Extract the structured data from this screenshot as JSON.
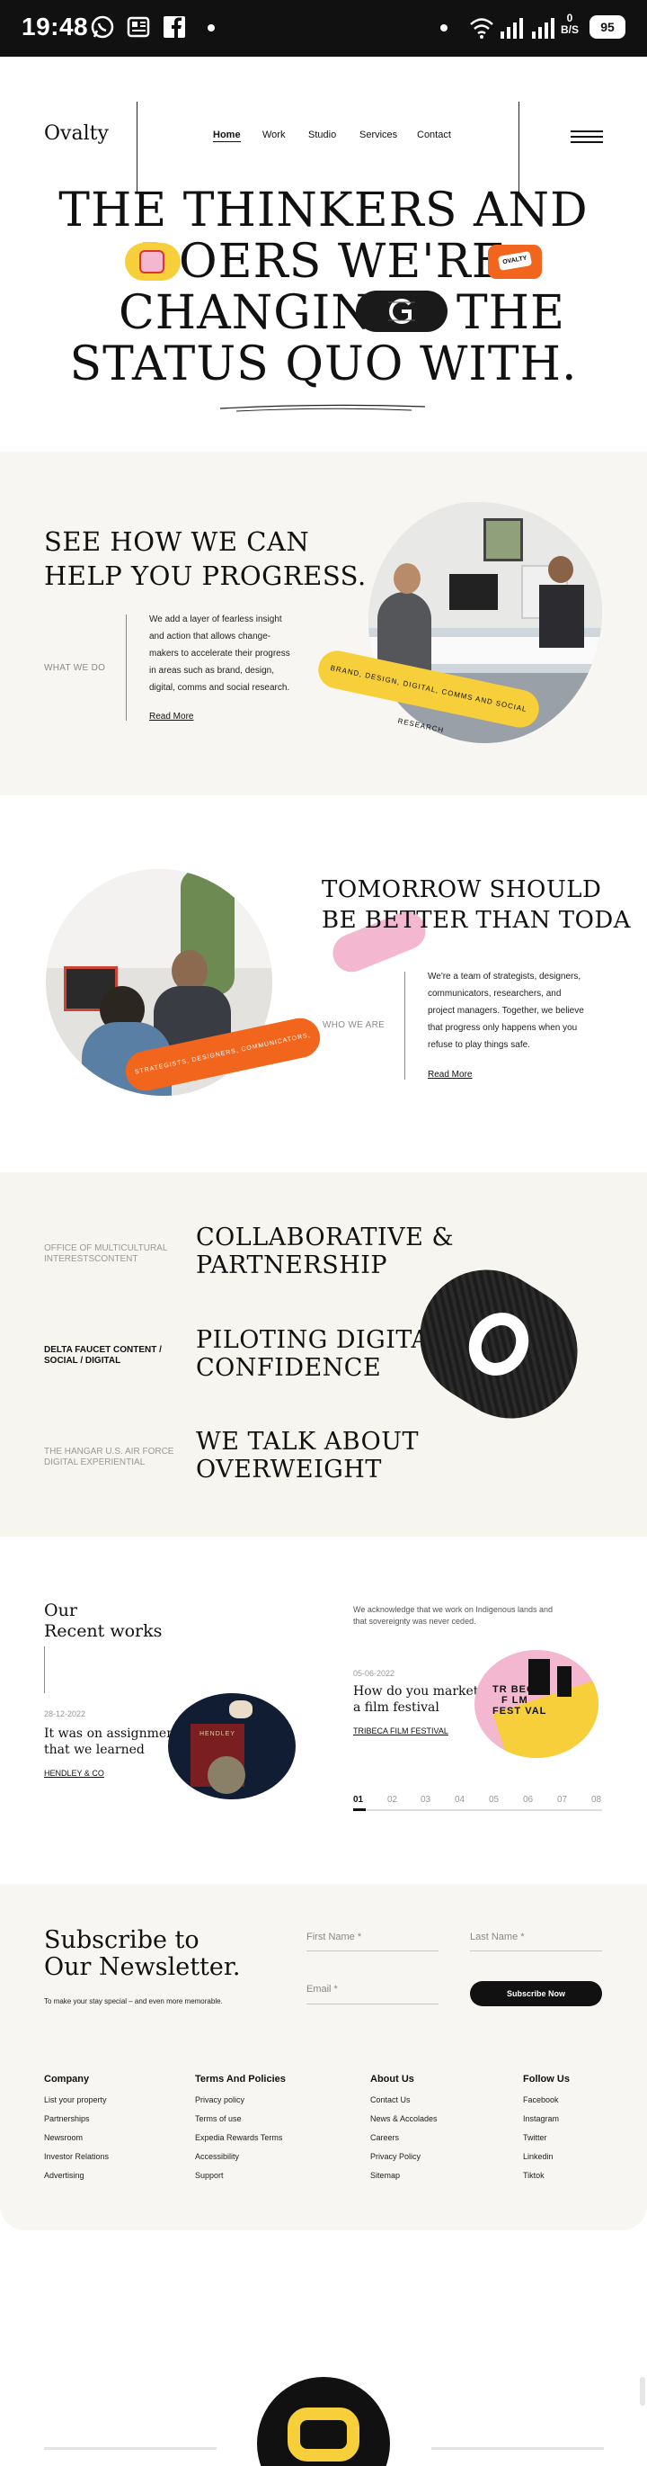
{
  "status_bar": {
    "time": "19:48",
    "net_speed_top": "0",
    "net_speed_bottom": "B/S",
    "battery": "95"
  },
  "header": {
    "logo": "Ovalty",
    "nav": [
      "Home",
      "Work",
      "Studio",
      "Services",
      "Contact"
    ]
  },
  "hero": {
    "line1": "THE THINKERS AND",
    "line2": "DOERS WE'RE",
    "line3_left": "CHANGING",
    "line3_right": "THE",
    "line4": "STATUS QUO WITH.",
    "sticker_text": "OVALTY"
  },
  "progress": {
    "title_line1": "SEE HOW WE CAN",
    "title_line2": "HELP YOU PROGRESS.",
    "label": "WHAT WE DO",
    "paragraph": [
      "We add a layer of fearless insight",
      "and action that allows change-",
      "makers to accelerate their progress",
      "in areas such as brand, design,",
      "digital, comms and social research."
    ],
    "link": "Read More",
    "ribbon": "BRAND, DESIGN, DIGITAL, COMMS AND SOCIAL RESEARCH"
  },
  "tomorrow": {
    "title_line1": "TOMORROW SHOULD",
    "title_line2": "BE BETTER THAN TODA",
    "label": "WHO WE ARE",
    "paragraph": [
      "We're a team of strategists, designers,",
      "communicators, researchers, and",
      "project managers. Together, we believe",
      "that progress only happens when you",
      "refuse to play things safe."
    ],
    "link": "Read More",
    "ribbon": "STRATEGISTS, DESIGNERS, COMMUNICATORS, RESEARCHERS"
  },
  "services": [
    {
      "label_line1": "OFFICE OF MULTICULTURAL",
      "label_line2": "INTERESTSCONTENT",
      "title_line1": "COLLABORATIVE &",
      "title_line2": "PARTNERSHIP"
    },
    {
      "label_line1": "DELTA FAUCET CONTENT /",
      "label_line2": "SOCIAL / DIGITAL",
      "title_line1": "PILOTING DIGITAL",
      "title_line2": "CONFIDENCE"
    },
    {
      "label_line1": "THE HANGAR U.S. AIR FORCE",
      "label_line2": "DIGITAL EXPERIENTIAL",
      "title_line1": "WE TALK ABOUT",
      "title_line2": "OVERWEIGHT"
    }
  ],
  "works": {
    "title_line1": "Our",
    "title_line2": "Recent works",
    "ack_line1": "We acknowledge that we work on Indigenous lands and",
    "ack_line2": "that sovereignty was never ceded.",
    "left": {
      "date": "28-12-2022",
      "title_line1": "It was on assignment",
      "title_line2": "that we learned",
      "client": "HENDLEY & CO",
      "card_brand": "HENDLEY"
    },
    "right": {
      "date": "05-06-2022",
      "title_line1": "How do you market",
      "title_line2": "a film festival",
      "client": "TRIBECA FILM FESTIVAL",
      "poster": [
        "TR",
        "BECA",
        "F",
        "LM",
        "FEST",
        "VAL"
      ]
    },
    "pager": [
      "01",
      "02",
      "03",
      "04",
      "05",
      "06",
      "07",
      "08"
    ],
    "active_page": 1
  },
  "subscribe": {
    "title_line1": "Subscribe to",
    "title_line2": "Our Newsletter.",
    "subtitle": "To make your stay special – and even more memorable.",
    "first_name": "First Name *",
    "last_name": "Last Name *",
    "email": "Email *",
    "button": "Subscribe Now"
  },
  "footer": {
    "columns": [
      {
        "title": "Company",
        "items": [
          "List your property",
          "Partnerships",
          "Newsroom",
          "Investor Relations",
          "Advertising"
        ]
      },
      {
        "title": "Terms And Policies",
        "items": [
          "Privacy policy",
          "Terms of use",
          "Expedia Rewards Terms",
          "Accessibility",
          "Support"
        ]
      },
      {
        "title": "About Us",
        "items": [
          "Contact Us",
          "News & Accolades",
          "Careers",
          "Privacy Policy",
          "Sitemap"
        ]
      },
      {
        "title": "Follow Us",
        "items": [
          "Facebook",
          "Instagram",
          "Twitter",
          "Linkedin",
          "Tiktok"
        ]
      }
    ]
  },
  "colors": {
    "accent_yellow": "#f7cf3a",
    "accent_orange": "#f2651c",
    "accent_pink": "#f3b8cf",
    "dark": "#111111",
    "section_bg": "#f8f6f2"
  }
}
